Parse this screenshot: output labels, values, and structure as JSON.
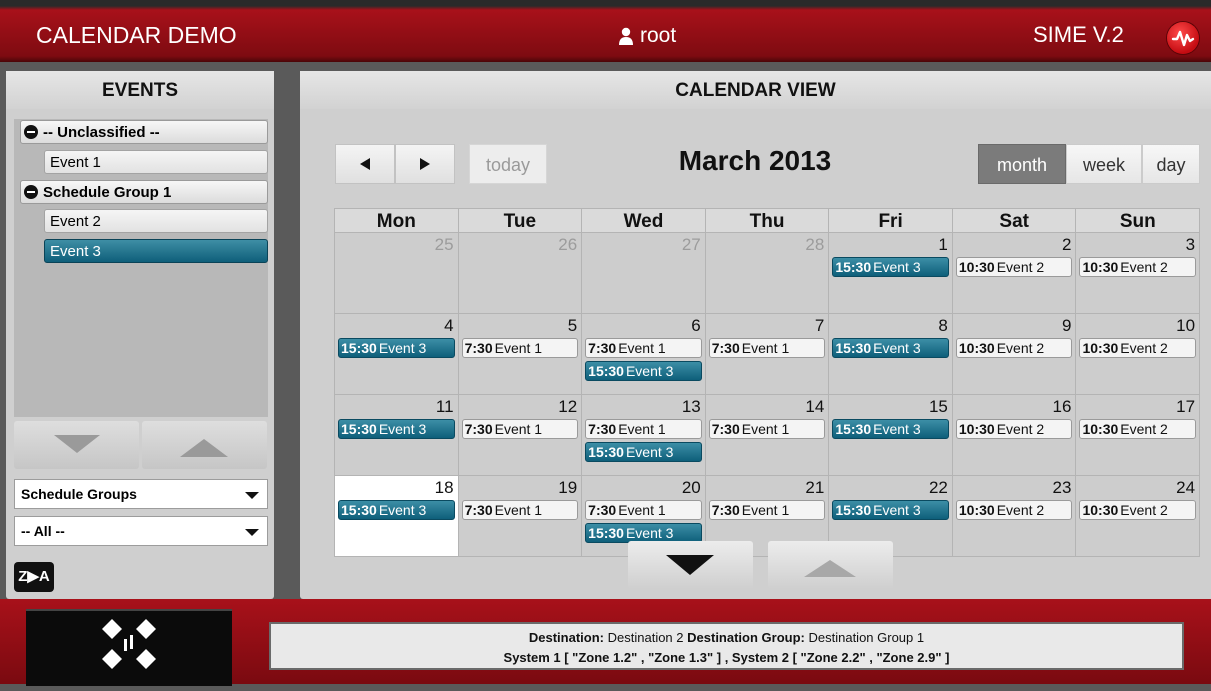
{
  "header": {
    "app_title": "CALENDAR DEMO",
    "user": "root",
    "version": "SIME V.2"
  },
  "events_panel": {
    "title": "EVENTS",
    "groups": [
      {
        "label": "-- Unclassified --",
        "items": [
          "Event 1"
        ]
      },
      {
        "label": "Schedule Group 1",
        "items": [
          "Event 2",
          "Event 3"
        ]
      }
    ],
    "selected_item": "Event 3",
    "group_select": "Schedule Groups",
    "filter_select": "-- All --",
    "sort_label": "Z▶A"
  },
  "calendar": {
    "title": "CALENDAR VIEW",
    "month_label": "March 2013",
    "today_label": "today",
    "views": [
      "month",
      "week",
      "day"
    ],
    "active_view": "month",
    "weekdays": [
      "Mon",
      "Tue",
      "Wed",
      "Thu",
      "Fri",
      "Sat",
      "Sun"
    ],
    "weeks": [
      [
        {
          "day": "25",
          "other": true,
          "events": []
        },
        {
          "day": "26",
          "other": true,
          "events": []
        },
        {
          "day": "27",
          "other": true,
          "events": []
        },
        {
          "day": "28",
          "other": true,
          "events": []
        },
        {
          "day": "1",
          "events": [
            {
              "time": "15:30",
              "title": "Event 3",
              "style": "teal"
            }
          ]
        },
        {
          "day": "2",
          "events": [
            {
              "time": "10:30",
              "title": "Event 2",
              "style": "gray"
            }
          ]
        },
        {
          "day": "3",
          "events": [
            {
              "time": "10:30",
              "title": "Event 2",
              "style": "gray"
            }
          ]
        }
      ],
      [
        {
          "day": "4",
          "events": [
            {
              "time": "15:30",
              "title": "Event 3",
              "style": "teal"
            }
          ]
        },
        {
          "day": "5",
          "events": [
            {
              "time": "7:30",
              "title": "Event 1",
              "style": "gray"
            }
          ]
        },
        {
          "day": "6",
          "events": [
            {
              "time": "7:30",
              "title": "Event 1",
              "style": "gray"
            },
            {
              "time": "15:30",
              "title": "Event 3",
              "style": "teal"
            }
          ]
        },
        {
          "day": "7",
          "events": [
            {
              "time": "7:30",
              "title": "Event 1",
              "style": "gray"
            }
          ]
        },
        {
          "day": "8",
          "events": [
            {
              "time": "15:30",
              "title": "Event 3",
              "style": "teal"
            }
          ]
        },
        {
          "day": "9",
          "events": [
            {
              "time": "10:30",
              "title": "Event 2",
              "style": "gray"
            }
          ]
        },
        {
          "day": "10",
          "events": [
            {
              "time": "10:30",
              "title": "Event 2",
              "style": "gray"
            }
          ]
        }
      ],
      [
        {
          "day": "11",
          "events": [
            {
              "time": "15:30",
              "title": "Event 3",
              "style": "teal"
            }
          ]
        },
        {
          "day": "12",
          "events": [
            {
              "time": "7:30",
              "title": "Event 1",
              "style": "gray"
            }
          ]
        },
        {
          "day": "13",
          "events": [
            {
              "time": "7:30",
              "title": "Event 1",
              "style": "gray"
            },
            {
              "time": "15:30",
              "title": "Event 3",
              "style": "teal"
            }
          ]
        },
        {
          "day": "14",
          "events": [
            {
              "time": "7:30",
              "title": "Event 1",
              "style": "gray"
            }
          ]
        },
        {
          "day": "15",
          "events": [
            {
              "time": "15:30",
              "title": "Event 3",
              "style": "teal"
            }
          ]
        },
        {
          "day": "16",
          "events": [
            {
              "time": "10:30",
              "title": "Event 2",
              "style": "gray"
            }
          ]
        },
        {
          "day": "17",
          "events": [
            {
              "time": "10:30",
              "title": "Event 2",
              "style": "gray"
            }
          ]
        }
      ],
      [
        {
          "day": "18",
          "today": true,
          "events": [
            {
              "time": "15:30",
              "title": "Event 3",
              "style": "teal"
            }
          ]
        },
        {
          "day": "19",
          "events": [
            {
              "time": "7:30",
              "title": "Event 1",
              "style": "gray"
            }
          ]
        },
        {
          "day": "20",
          "events": [
            {
              "time": "7:30",
              "title": "Event 1",
              "style": "gray"
            },
            {
              "time": "15:30",
              "title": "Event 3",
              "style": "teal"
            }
          ]
        },
        {
          "day": "21",
          "events": [
            {
              "time": "7:30",
              "title": "Event 1",
              "style": "gray"
            }
          ]
        },
        {
          "day": "22",
          "events": [
            {
              "time": "15:30",
              "title": "Event 3",
              "style": "teal"
            }
          ]
        },
        {
          "day": "23",
          "events": [
            {
              "time": "10:30",
              "title": "Event 2",
              "style": "gray"
            }
          ]
        },
        {
          "day": "24",
          "events": [
            {
              "time": "10:30",
              "title": "Event 2",
              "style": "gray"
            }
          ]
        }
      ]
    ]
  },
  "footer": {
    "destination_label": "Destination:",
    "destination_value": "Destination 2",
    "destination_group_label": "Destination Group:",
    "destination_group_value": "Destination Group 1",
    "system_line": "System 1 [ \"Zone 1.2\" , \"Zone 1.3\" ] , System 2 [ \"Zone 2.2\" , \"Zone 2.9\" ]"
  },
  "colors": {
    "accent_red": "#a8111a",
    "event_teal": "#0f5f7a",
    "header_text": "#ffffff"
  },
  "icons": [
    "user-icon",
    "waveform-logo-icon",
    "prev-arrow-icon",
    "next-arrow-icon",
    "down-arrow-icon",
    "up-arrow-icon",
    "collapse-icon",
    "diamond-logo-icon"
  ]
}
